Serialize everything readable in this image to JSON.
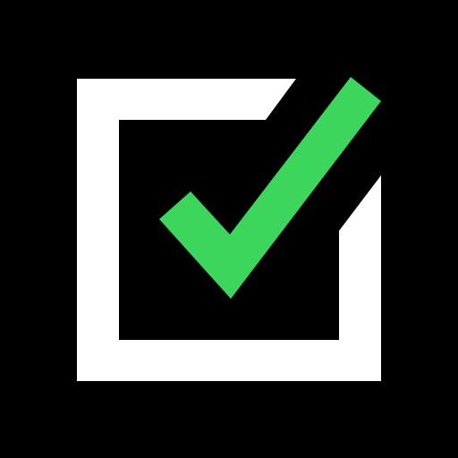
{
  "icon": {
    "name": "checkbox-checked-icon",
    "colors": {
      "background": "#000000",
      "box": "#FFFFFF",
      "checkmark": "#3DD65C"
    }
  }
}
